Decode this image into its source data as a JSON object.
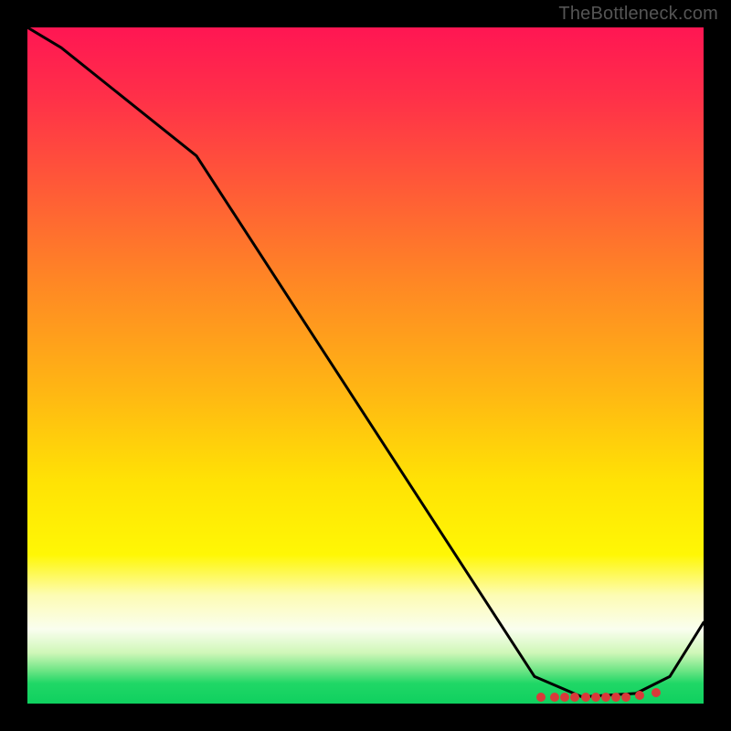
{
  "attribution": "TheBottleneck.com",
  "chart_data": {
    "type": "line",
    "title": "",
    "xlabel": "",
    "ylabel": "",
    "xlim": [
      0,
      100
    ],
    "ylim": [
      0,
      100
    ],
    "grid": false,
    "legend": false,
    "series": [
      {
        "name": "curve",
        "x": [
          0,
          5,
          25,
          75,
          82,
          90,
          95,
          100
        ],
        "values": [
          100,
          97,
          81,
          4,
          1,
          1.5,
          4,
          12
        ]
      }
    ],
    "markers": {
      "x": [
        76,
        78,
        79.5,
        81,
        82.5,
        84,
        85.5,
        87,
        88.5,
        90.5,
        93
      ],
      "values": [
        1,
        1,
        1,
        1,
        1,
        1,
        1,
        1,
        1,
        1.2,
        1.6
      ]
    },
    "background_gradient_stops": [
      {
        "pct": 0,
        "color": "#ff1653"
      },
      {
        "pct": 10,
        "color": "#ff2f49"
      },
      {
        "pct": 23,
        "color": "#ff5838"
      },
      {
        "pct": 38,
        "color": "#ff8824"
      },
      {
        "pct": 54,
        "color": "#ffb713"
      },
      {
        "pct": 67,
        "color": "#ffe205"
      },
      {
        "pct": 78,
        "color": "#fff705"
      },
      {
        "pct": 84,
        "color": "#fdfcb4"
      },
      {
        "pct": 89,
        "color": "#fafeef"
      },
      {
        "pct": 92.5,
        "color": "#cff7b8"
      },
      {
        "pct": 95,
        "color": "#72e687"
      },
      {
        "pct": 97,
        "color": "#20d766"
      },
      {
        "pct": 100,
        "color": "#0fd05f"
      }
    ]
  }
}
